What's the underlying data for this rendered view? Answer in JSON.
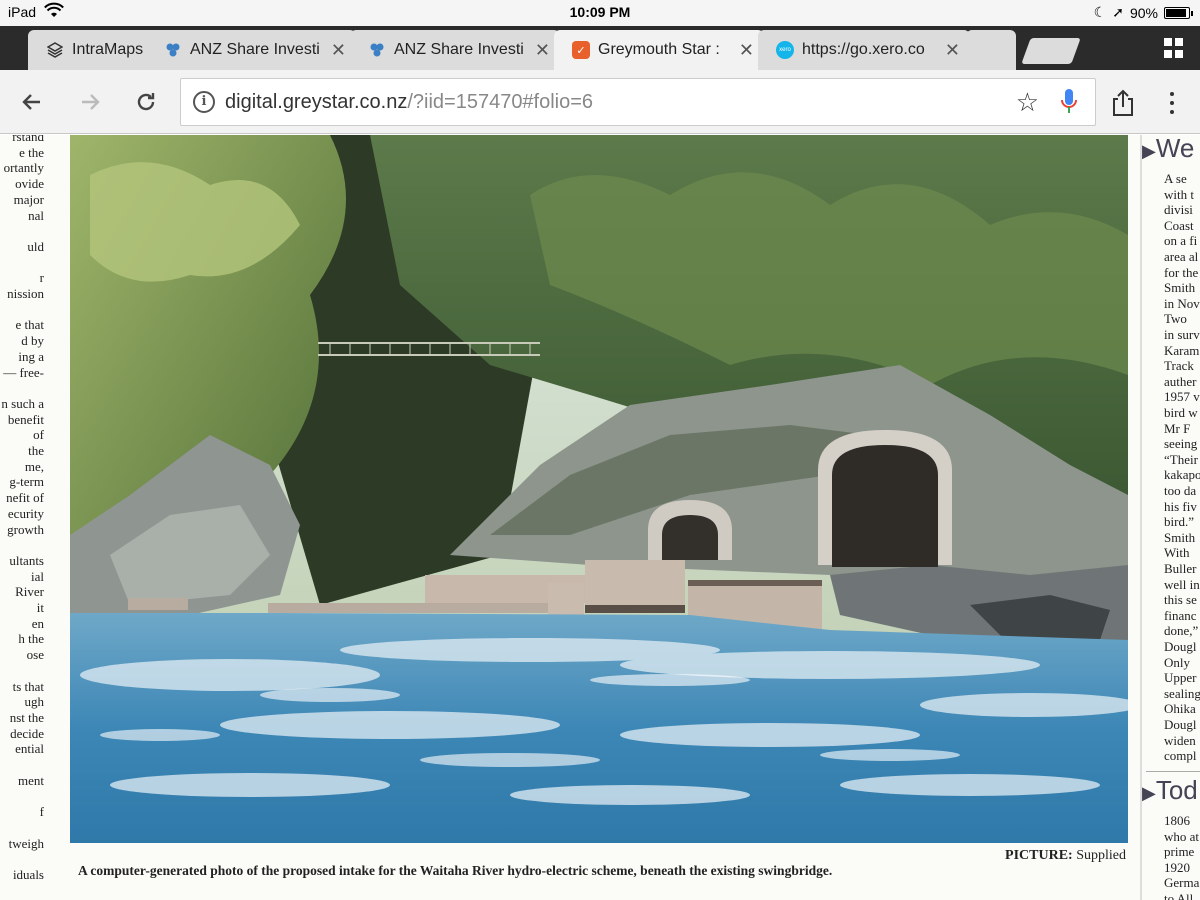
{
  "status_bar": {
    "carrier": "iPad",
    "time": "10:09 PM",
    "battery": "90%",
    "battery_level": 0.9
  },
  "tabs": [
    {
      "label": "IntraMaps",
      "favicon": "layers-icon",
      "active": false,
      "closable": false
    },
    {
      "label": "ANZ Share Investi",
      "favicon": "anz-icon",
      "active": false,
      "closable": true
    },
    {
      "label": "ANZ Share Investi",
      "favicon": "anz-icon",
      "active": false,
      "closable": true
    },
    {
      "label": "Greymouth Star :",
      "favicon": "greystar-icon",
      "active": true,
      "closable": true
    },
    {
      "label": "https://go.xero.co",
      "favicon": "xero-icon",
      "favicon_text": "xero",
      "active": false,
      "closable": true
    }
  ],
  "toolbar": {
    "url_host": "digital.greystar.co.nz",
    "url_path": "/?iid=157470#folio=6"
  },
  "article": {
    "left_column_lines": [
      "rstand",
      "e the",
      "ortantly",
      "ovide",
      "major",
      "nal",
      "",
      "uld",
      "",
      "r",
      "nission",
      "",
      "e that",
      "d by",
      "ing a",
      "— free-",
      "",
      "n such a",
      "benefit",
      "of",
      "the",
      "me,",
      "g-term",
      "nefit of",
      "ecurity",
      "growth",
      "",
      "ultants",
      "ial",
      "River",
      "it",
      "en",
      "h the",
      "ose",
      "",
      "ts that",
      "ugh",
      "nst the",
      "decide",
      "ential",
      "",
      "ment",
      "",
      "f",
      "",
      "tweigh",
      "",
      "iduals"
    ],
    "photo_caption": "A computer-generated photo of the proposed intake for the Waitaha River hydro-electric scheme, beneath the existing swingbridge.",
    "credit_label": "PICTURE:",
    "credit_value": "Supplied",
    "right_heading_1": "We",
    "right_column_lines": [
      "A se",
      "with t",
      "divisi",
      "Coast",
      "on a fi",
      "area al",
      "for the",
      "Smith",
      "in Nov",
      "Two",
      "in surv",
      "Karam",
      "Track",
      "auther",
      "1957 v",
      "bird w",
      "Mr F",
      "seeing",
      "“Their",
      "kakapo",
      "too da",
      "his fiv",
      "bird.”",
      "Smith",
      "With",
      "Buller",
      "well in",
      "this se",
      "financ",
      "done,”",
      "Dougl",
      "Only",
      "Upper",
      "sealing",
      "Ohika",
      "Dougl",
      "widen",
      "compl"
    ],
    "right_heading_2": "Tod",
    "right_column_lines_2": [
      "1806",
      "who at",
      "prime",
      "1920",
      "Germa",
      "to All"
    ]
  }
}
